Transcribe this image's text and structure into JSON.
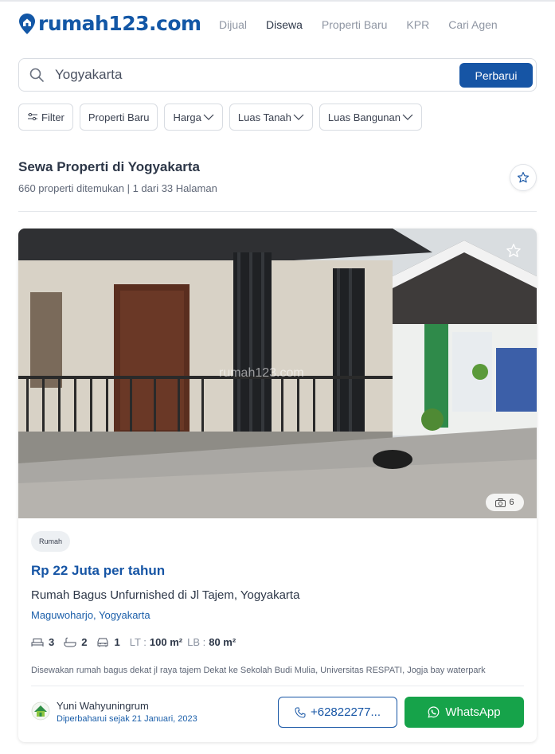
{
  "header": {
    "logo_text": "rumah123.com",
    "nav": [
      {
        "label": "Dijual",
        "active": false
      },
      {
        "label": "Disewa",
        "active": true
      },
      {
        "label": "Properti Baru",
        "active": false
      },
      {
        "label": "KPR",
        "active": false
      },
      {
        "label": "Cari Agen",
        "active": false
      }
    ]
  },
  "search": {
    "value": "Yogyakarta",
    "button_label": "Perbarui"
  },
  "filters": {
    "filter_label": "Filter",
    "new_property_label": "Properti Baru",
    "price_label": "Harga",
    "land_area_label": "Luas Tanah",
    "building_area_label": "Luas Bangunan"
  },
  "results": {
    "title": "Sewa Properti di Yogyakarta",
    "summary": "660 properti ditemukan | 1 dari 33 Halaman"
  },
  "listing": {
    "photo_count": "6",
    "watermark": "rumah123.com",
    "type": "Rumah",
    "price": "Rp 22 Juta per tahun",
    "title": "Rumah Bagus Unfurnished di Jl Tajem, Yogyakarta",
    "location": "Maguwoharjo, Yogyakarta",
    "bedrooms": "3",
    "bathrooms": "2",
    "garage": "1",
    "land_label": "LT :",
    "land_area": "100 m²",
    "building_label": "LB :",
    "building_area": "80 m²",
    "description": "Disewakan rumah bagus dekat jl raya tajem Dekat ke Sekolah Budi Mulia, Universitas RESPATI, Jogja bay waterpark",
    "agent_name": "Yuni Wahyuningrum",
    "updated": "Diperbaharui sejak 21 Januari, 2023",
    "phone_label": "+62822277...",
    "whatsapp_label": "WhatsApp"
  },
  "colors": {
    "brand": "#1655a5",
    "whatsapp": "#16a34a"
  }
}
